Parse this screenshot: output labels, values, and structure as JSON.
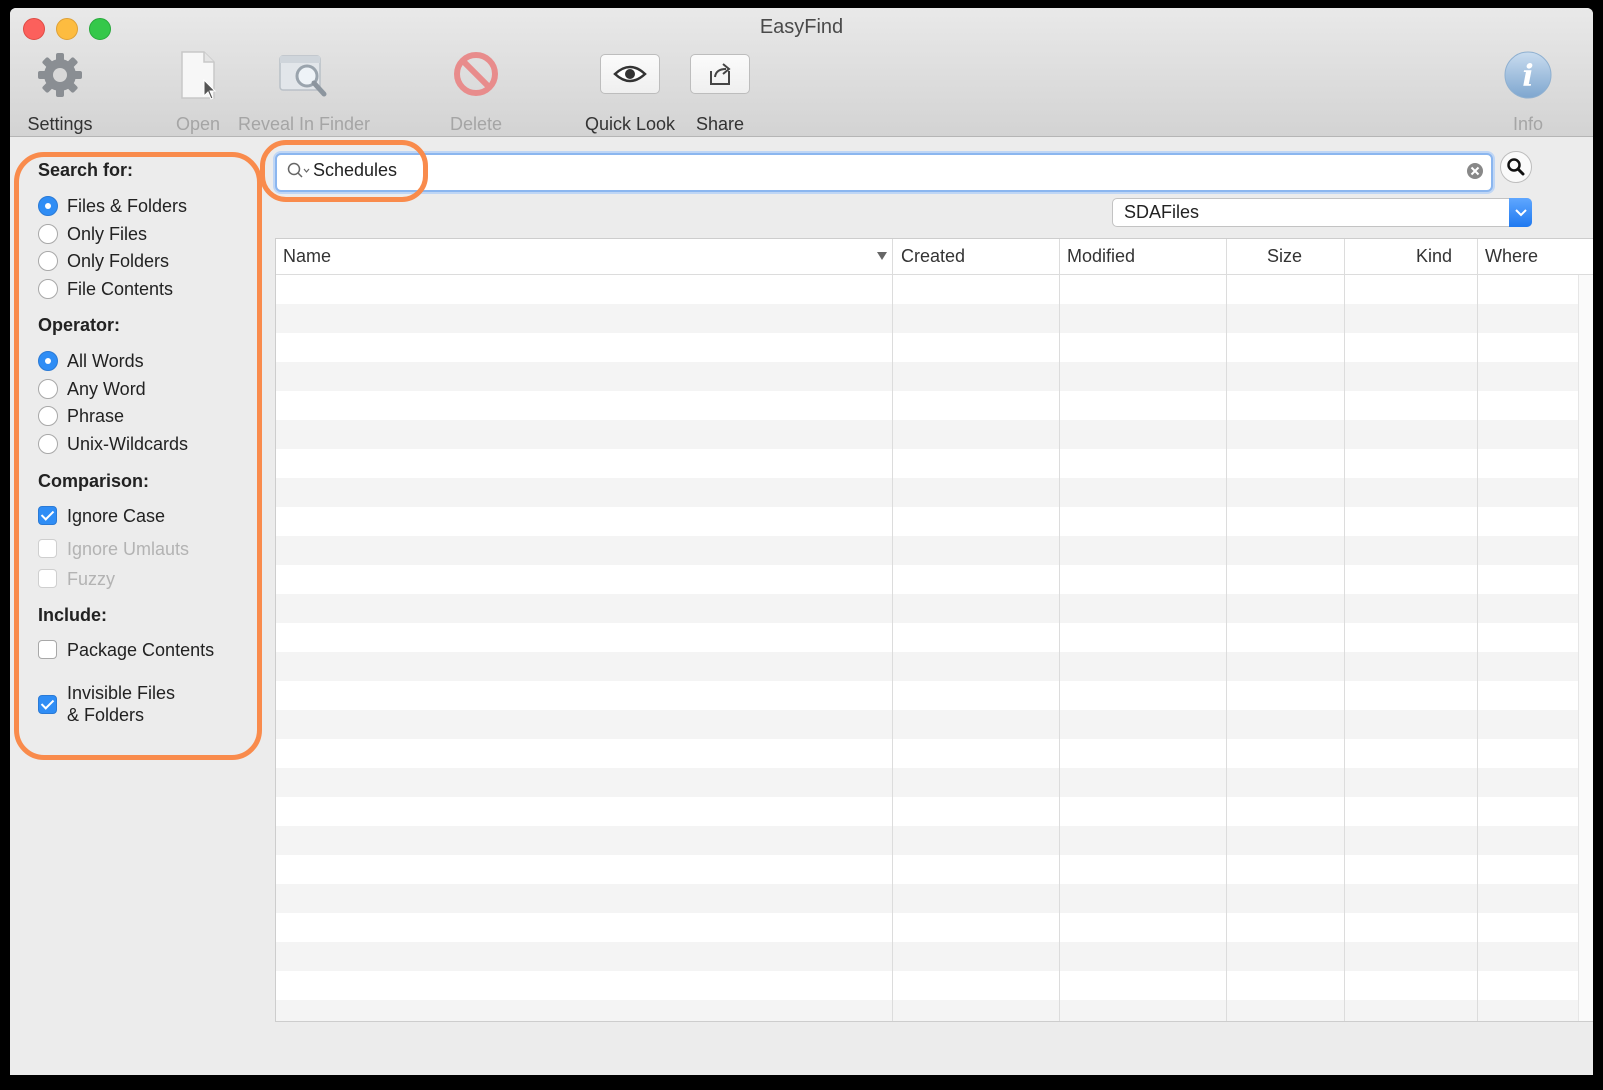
{
  "window": {
    "title": "EasyFind"
  },
  "toolbar": {
    "settings": "Settings",
    "open": "Open",
    "reveal": "Reveal In Finder",
    "delete": "Delete",
    "quick_look": "Quick Look",
    "share": "Share",
    "info": "Info"
  },
  "left_panel": {
    "search_for": {
      "title": "Search for:",
      "options": [
        "Files & Folders",
        "Only Files",
        "Only Folders",
        "File Contents"
      ],
      "selected": "Files & Folders"
    },
    "operator": {
      "title": "Operator:",
      "options": [
        "All Words",
        "Any Word",
        "Phrase",
        "Unix-Wildcards"
      ],
      "selected": "All Words"
    },
    "comparison": {
      "title": "Comparison:",
      "ignore_case": "Ignore Case",
      "ignore_umlauts": "Ignore Umlauts",
      "fuzzy": "Fuzzy"
    },
    "include": {
      "title": "Include:",
      "package_contents": "Package Contents",
      "invisible_line1": "Invisible Files",
      "invisible_line2": "& Folders"
    }
  },
  "search": {
    "value": "Schedules"
  },
  "location": {
    "selected": "SDAFiles"
  },
  "table": {
    "columns": [
      "Name",
      "Created",
      "Modified",
      "Size",
      "Kind",
      "Where"
    ],
    "rows": []
  },
  "colors": {
    "accent": "#2f8df5",
    "highlight": "#f98b4c"
  }
}
